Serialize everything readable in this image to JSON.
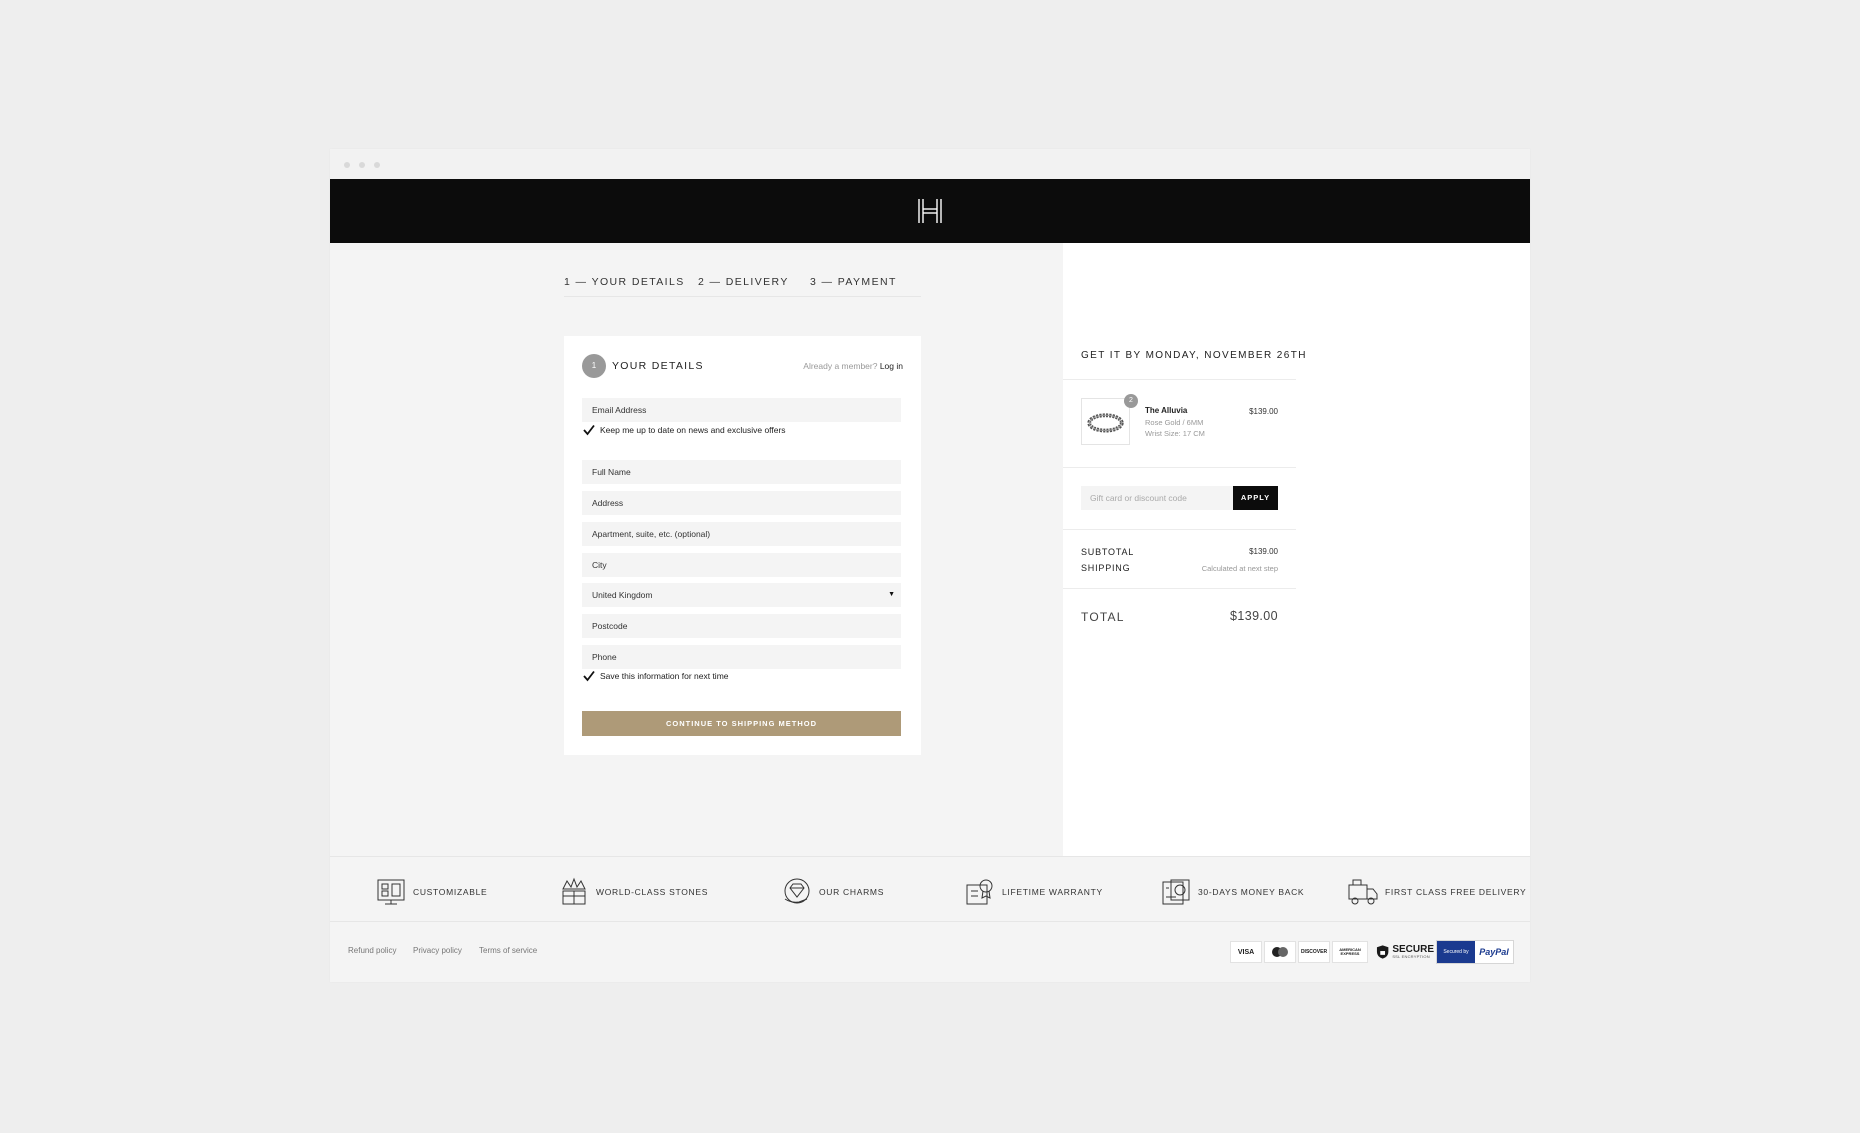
{
  "brand": {
    "logo_icon": "h-monogram-logo"
  },
  "steps": [
    {
      "label": "1 — YOUR DETAILS",
      "active": true
    },
    {
      "label": "2 — DELIVERY",
      "active": false
    },
    {
      "label": "3 — PAYMENT",
      "active": false
    }
  ],
  "details": {
    "step_number": "1",
    "title": "YOUR DETAILS",
    "member_prompt": "Already a member?",
    "login_label": "Log in",
    "fields": {
      "email": "Email Address",
      "full_name": "Full Name",
      "address": "Address",
      "apartment": "Apartment, suite, etc. (optional)",
      "city": "City",
      "country": "United Kingdom",
      "postcode": "Postcode",
      "phone": "Phone"
    },
    "newsletter_label": "Keep me up to date on news and exclusive offers",
    "newsletter_checked": true,
    "save_info_label": "Save this information for next time",
    "save_info_checked": true,
    "continue_label": "CONTINUE TO SHIPPING METHOD"
  },
  "summary": {
    "delivery_estimate": "GET IT BY MONDAY, NOVEMBER 26TH",
    "product": {
      "quantity": "2",
      "name": "The Alluvia",
      "variant": "Rose Gold / 6MM",
      "wrist_size": "Wrist Size: 17 CM",
      "price": "$139.00"
    },
    "discount_placeholder": "Gift card or discount code",
    "apply_label": "APPLY",
    "subtotal_label": "SUBTOTAL",
    "subtotal_value": "$139.00",
    "shipping_label": "SHIPPING",
    "shipping_value": "Calculated at next step",
    "total_label": "TOTAL",
    "total_value": "$139.00"
  },
  "features": [
    {
      "label": "CUSTOMIZABLE",
      "icon": "customize-screen-icon"
    },
    {
      "label": "WORLD-CLASS STONES",
      "icon": "crown-gift-icon"
    },
    {
      "label": "OUR CHARMS",
      "icon": "diamond-hand-icon"
    },
    {
      "label": "LIFETIME WARRANTY",
      "icon": "warranty-badge-icon"
    },
    {
      "label": "30-DAYS MONEY BACK",
      "icon": "money-back-icon"
    },
    {
      "label": "FIRST CLASS FREE DELIVERY",
      "icon": "delivery-truck-icon"
    }
  ],
  "footer": {
    "links": [
      "Refund policy",
      "Privacy policy",
      "Terms of service"
    ],
    "payments": {
      "visa": "VISA",
      "mastercard_icon": "mastercard-icon",
      "discover": "DISCOVER",
      "amex": "AMERICAN EXPRESS",
      "secure_big": "SECURE",
      "secure_small": "SSL ENCRYPTION",
      "secured_by": "Secured by",
      "paypal": "PayPal"
    }
  },
  "colors": {
    "accent_gold": "#ae9a78",
    "header_black": "#0c0c0c",
    "background": "#f4f4f4"
  }
}
